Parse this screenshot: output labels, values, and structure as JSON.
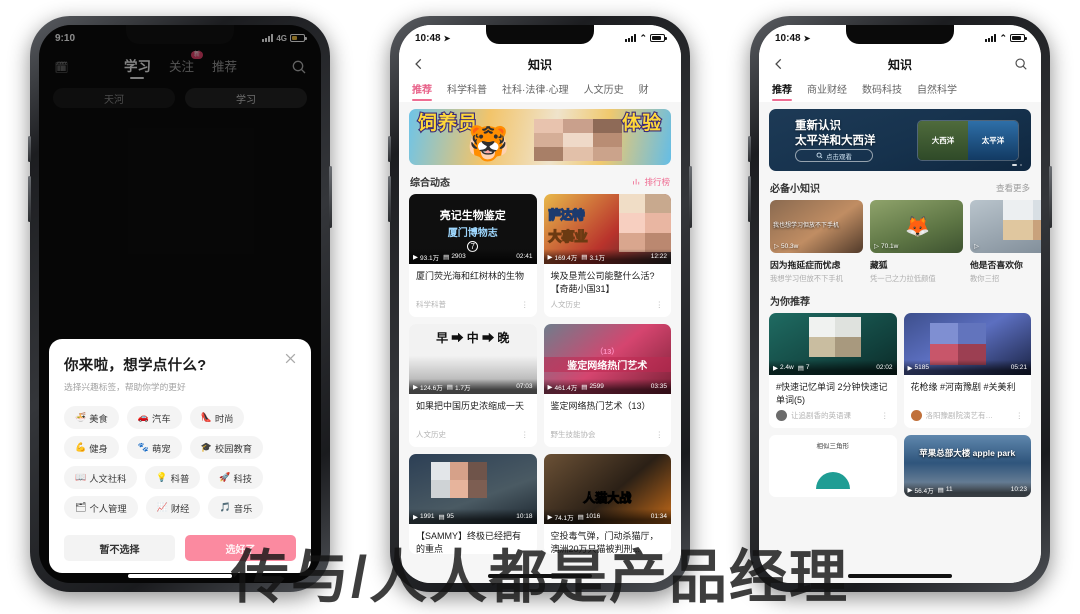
{
  "watermark": "传与/人人都是产品经理",
  "phone1": {
    "status": {
      "time": "9:10",
      "network": "4G"
    },
    "nav": {
      "logo_icon": "calendar-icon",
      "tabs": [
        {
          "label": "学习",
          "active": true
        },
        {
          "label": "关注",
          "active": false,
          "badge": "新"
        },
        {
          "label": "推荐",
          "active": false
        }
      ],
      "search_icon": "search-icon"
    },
    "pills": [
      {
        "label": "天河",
        "selected": false
      },
      {
        "label": "学习",
        "selected": true
      }
    ],
    "modal": {
      "title": "你来啦，想学点什么?",
      "subtitle": "选择兴趣标签，帮助你学的更好",
      "close_icon": "close-icon",
      "chips": [
        {
          "emoji": "🍜",
          "label": "美食"
        },
        {
          "emoji": "🚗",
          "label": "汽车"
        },
        {
          "emoji": "👠",
          "label": "时尚"
        },
        {
          "emoji": "💪",
          "label": "健身"
        },
        {
          "emoji": "🐾",
          "label": "萌宠"
        },
        {
          "emoji": "🎓",
          "label": "校园教育"
        },
        {
          "emoji": "📖",
          "label": "人文社科"
        },
        {
          "emoji": "💡",
          "label": "科普"
        },
        {
          "emoji": "🚀",
          "label": "科技"
        },
        {
          "emoji": "🗂",
          "label": "个人管理"
        },
        {
          "emoji": "📈",
          "label": "财经"
        },
        {
          "emoji": "🎵",
          "label": "音乐"
        }
      ],
      "secondary_button": "暂不选择",
      "primary_button": "选好了"
    }
  },
  "phone2": {
    "status": {
      "time": "10:48",
      "location_icon": "location-arrow-icon"
    },
    "topbar": {
      "back_icon": "back-chevron-icon",
      "title": "知识"
    },
    "cattabs": [
      {
        "label": "推荐",
        "active": true
      },
      {
        "label": "科学科普",
        "active": false
      },
      {
        "label": "社科·法律·心理",
        "active": false
      },
      {
        "label": "人文历史",
        "active": false
      },
      {
        "label": "财",
        "active": false
      }
    ],
    "banner": {
      "left_text": "饲养员",
      "right_text": "体验",
      "art_icon": "tiger-icon"
    },
    "section": {
      "title": "综合动态",
      "rank_label": "排行榜",
      "rank_icon": "chart-bars-icon"
    },
    "cards": [
      {
        "cover_title": "亮记生物鉴定",
        "cover_sub": "厦门博物志",
        "cover_num": "7",
        "plays": "93.1万",
        "comments": "2903",
        "duration": "02:41",
        "title": "厦门荧光海和红树林的生物",
        "channel": "科学科普"
      },
      {
        "cover_title": "萨达特",
        "cover_sub": "大事业",
        "plays": "169.4万",
        "comments": "3.1万",
        "duration": "12:22",
        "title": "埃及垦荒公司能整什么活?【奇葩小国31】",
        "channel": "人文历史"
      },
      {
        "cover_title": "早 ➡ 中 ➡ 晚",
        "cover_sub": "",
        "plays": "124.6万",
        "comments": "1.7万",
        "duration": "07:03",
        "title": "如果把中国历史浓缩成一天",
        "channel": "人文历史"
      },
      {
        "cover_title": "鉴定网络热门艺术",
        "cover_sub": "（13）",
        "plays": "461.4万",
        "comments": "2599",
        "duration": "03:35",
        "title": "鉴定网络热门艺术（13）",
        "channel": "野生技能协会"
      },
      {
        "cover_title": "",
        "cover_sub": "",
        "plays": "1991",
        "comments": "95",
        "duration": "10:18",
        "title": "【SAMMY】终极已经把有的重点",
        "channel": ""
      },
      {
        "cover_title": "人猫大战",
        "cover_sub": "",
        "plays": "74.1万",
        "comments": "1016",
        "duration": "01:34",
        "title": "空投毒气弹，门动杀猫厅，澳洲20万只猫被判刑...",
        "channel": ""
      }
    ]
  },
  "phone3": {
    "status": {
      "time": "10:48",
      "location_icon": "location-arrow-icon"
    },
    "topbar": {
      "back_icon": "back-chevron-icon",
      "title": "知识",
      "search_icon": "search-icon"
    },
    "cattabs": [
      {
        "label": "推荐",
        "active": true
      },
      {
        "label": "商业财经",
        "active": false
      },
      {
        "label": "数码科技",
        "active": false
      },
      {
        "label": "自然科学",
        "active": false
      }
    ],
    "banner": {
      "line1": "重新认识",
      "line2": "太平洋和大西洋",
      "cta": "点击观看",
      "cta_icon": "search-icon",
      "img_left_label": "大西洋",
      "img_right_label": "太平洋"
    },
    "sections": [
      {
        "title": "必备小知识",
        "more": "查看更多"
      },
      {
        "title": "为你推荐",
        "more": ""
      }
    ],
    "hcards": [
      {
        "overlay": "我也想学习但放不下手机",
        "plays": "50.3w",
        "title": "因为拖延症而忧虑",
        "sub": "我想学习但放不下手机"
      },
      {
        "overlay": "",
        "plays": "70.1w",
        "title": "藏狐",
        "sub": "凭一己之力拉低颜值"
      },
      {
        "overlay": "",
        "plays": "",
        "title": "他是否喜欢你",
        "sub": "教你三招"
      }
    ],
    "reco": [
      {
        "plays": "2.4w",
        "comments": "7",
        "duration": "02:02",
        "title": "#快速记忆单词 2分钟快速记单词(5)",
        "author": "让追剧香的英语课"
      },
      {
        "plays": "5185",
        "comments": "",
        "duration": "05:21",
        "title": "花枪缘 #河南豫剧 #关美利",
        "author": "洛阳豫剧院演艺有…"
      },
      {
        "plays": "",
        "comments": "",
        "duration": "",
        "title": "相似三角形",
        "author": ""
      },
      {
        "plays": "56.4万",
        "comments": "11",
        "duration": "10:23",
        "title": "苹果总部大楼 apple park",
        "author": ""
      }
    ]
  }
}
